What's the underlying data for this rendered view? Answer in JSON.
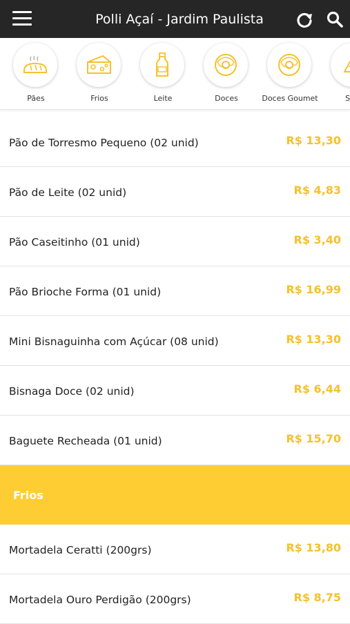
{
  "header": {
    "title": "Polli Açaí - Jardim Paulista",
    "menu_icon": "hamburger-menu-icon",
    "refresh_icon": "refresh-icon",
    "search_icon": "search-icon"
  },
  "categories": [
    {
      "label": "Pães",
      "icon": "bread-icon"
    },
    {
      "label": "Frios",
      "icon": "cheese-icon"
    },
    {
      "label": "Leite",
      "icon": "milk-bottle-icon"
    },
    {
      "label": "Doces",
      "icon": "donut-icon"
    },
    {
      "label": "Doces Goumet",
      "icon": "donut-icon"
    },
    {
      "label": "Salg",
      "icon": "savory-snack-icon"
    }
  ],
  "products": [
    {
      "name": "Pão de Torresmo Pequeno (02 unid)",
      "price": "R$ 13,30"
    },
    {
      "name": "Pão de Leite (02 unid)",
      "price": "R$ 4,83"
    },
    {
      "name": "Pão Caseitinho (01 unid)",
      "price": "R$ 3,40"
    },
    {
      "name": "Pão Brioche Forma (01 unid)",
      "price": "R$ 16,99"
    },
    {
      "name": "Mini Bisnaguinha com Açúcar (08 unid)",
      "price": "R$ 13,30"
    },
    {
      "name": "Bisnaga Doce (02 unid)",
      "price": "R$ 6,44"
    },
    {
      "name": "Baguete Recheada (01 unid)",
      "price": "R$ 15,70"
    }
  ],
  "section": {
    "name": "Frios"
  },
  "frios_products": [
    {
      "name": "Mortadela Ceratti (200grs)",
      "price": "R$ 13,80"
    },
    {
      "name": "Mortadela Ouro Perdigão (200grs)",
      "price": "R$ 8,75"
    }
  ],
  "colors": {
    "accent": "#fecd33",
    "price": "#f6c12a",
    "topbar": "#262626"
  }
}
